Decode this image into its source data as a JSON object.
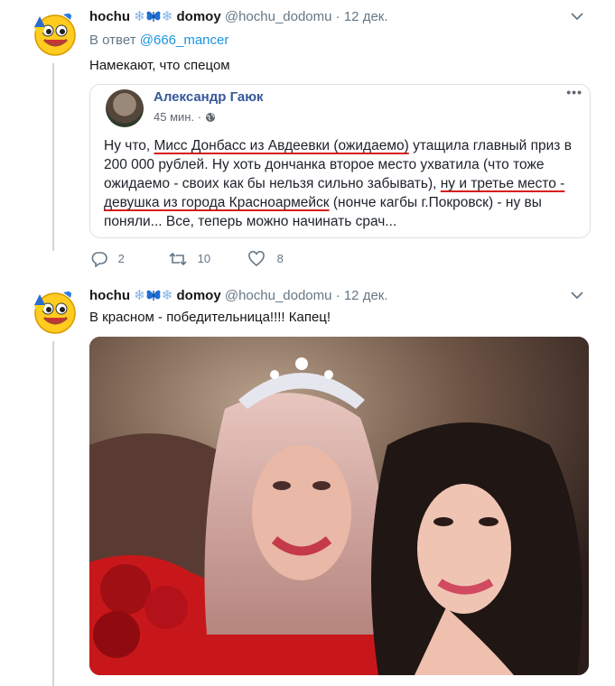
{
  "tweet1": {
    "name": "hochu",
    "name2": "domoy",
    "handle": "@hochu_dodomu",
    "separator": "·",
    "date": "12 дек.",
    "reply_prefix": "В ответ",
    "reply_handle": "@666_mancer",
    "text": "Намекают, что спецом",
    "fb_post": {
      "author": "Александр Гаюк",
      "time": "45 мин.",
      "text_parts": [
        "Ну что, ",
        "Мисс Донбасс из Авдеевки (ожидаемо)",
        " утащила главный приз в 200 000 рублей. Ну хоть дончанка второе место ухватила (что тоже ожидаемо - своих как бы нельзя сильно забывать), ",
        "ну и третье место - девушка из города Красноармейск",
        " (нонче кагбы г.Покровск) - ну вы поняли... Все, теперь можно начинать срач..."
      ]
    },
    "actions": {
      "replies": "2",
      "retweets": "10",
      "likes": "8"
    }
  },
  "tweet2": {
    "name": "hochu",
    "name2": "domoy",
    "handle": "@hochu_dodomu",
    "separator": "·",
    "date": "12 дек.",
    "text": "В красном - победительница!!!! Капец!"
  },
  "colors": {
    "link": "#1b95e0",
    "muted": "#657786",
    "fb_name": "#365899",
    "underline": "#d81d1d"
  },
  "icons": [
    "emoji-avatar-icon",
    "snowflake-icon",
    "butterfly-icon",
    "chevron-down-icon",
    "globe-icon",
    "reply-icon",
    "retweet-icon",
    "heart-icon"
  ]
}
